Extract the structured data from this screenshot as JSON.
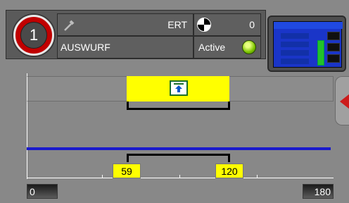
{
  "header": {
    "station_number": "1",
    "tool_label": "ERT",
    "counter_value": "0",
    "program_name": "AUSWURF",
    "status_text": "Active"
  },
  "timeline": {
    "marker_start": "59",
    "marker_end": "120",
    "scale_min": "0",
    "scale_max": "180"
  },
  "icons": {
    "tool": "wrench-icon",
    "cycle": "cycle-icon",
    "led": "status-led-icon",
    "action": "eject-up-icon",
    "nav": "chevron-left-icon"
  },
  "colors": {
    "station_ring": "#c00000",
    "active_segment": "#ffff00",
    "signal_line": "#1a1acc",
    "status_led": "#7cc400"
  }
}
